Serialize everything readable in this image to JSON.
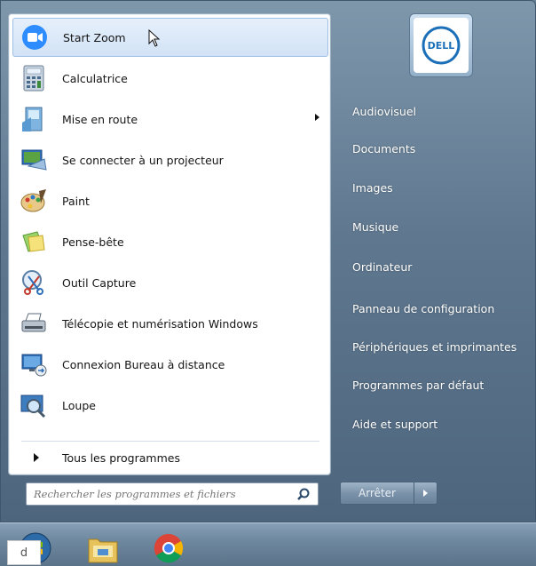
{
  "programs": [
    {
      "label": "Start Zoom",
      "icon": "zoom-icon",
      "highlighted": true
    },
    {
      "label": "Calculatrice",
      "icon": "calculator-icon"
    },
    {
      "label": "Mise en route",
      "icon": "getting-started-icon",
      "has_submenu": true
    },
    {
      "label": "Se connecter à un projecteur",
      "icon": "projector-icon"
    },
    {
      "label": "Paint",
      "icon": "paint-icon"
    },
    {
      "label": "Pense-bête",
      "icon": "sticky-notes-icon"
    },
    {
      "label": "Outil Capture",
      "icon": "snipping-tool-icon"
    },
    {
      "label": "Télécopie et numérisation Windows",
      "icon": "fax-scan-icon"
    },
    {
      "label": "Connexion Bureau à distance",
      "icon": "remote-desktop-icon"
    },
    {
      "label": "Loupe",
      "icon": "magnifier-icon"
    }
  ],
  "all_programs": {
    "label": "Tous les programmes"
  },
  "search": {
    "placeholder": "Rechercher les programmes et fichiers",
    "icon": "search-icon"
  },
  "right_links": [
    {
      "label": "Audiovisuel"
    },
    {
      "label": "Documents"
    },
    {
      "label": "Images"
    },
    {
      "label": "Musique"
    },
    {
      "label": "Ordinateur"
    },
    {
      "label": "Panneau de configuration"
    },
    {
      "label": "Périphériques et imprimantes"
    },
    {
      "label": "Programmes par défaut"
    },
    {
      "label": "Aide et support"
    }
  ],
  "user_tile": {
    "logo": "dell-logo",
    "text": "DELL"
  },
  "shutdown": {
    "label": "Arrêter",
    "arrow_icon": "chevron-right-icon"
  },
  "taskbar": {
    "icons": [
      "start-orb-icon",
      "file-explorer-icon",
      "chrome-icon"
    ]
  },
  "corner_label": "d",
  "colors": {
    "zoom_blue": "#2d8cff",
    "highlight": "#d2e3f6",
    "menu_bg": "#5f7890"
  }
}
